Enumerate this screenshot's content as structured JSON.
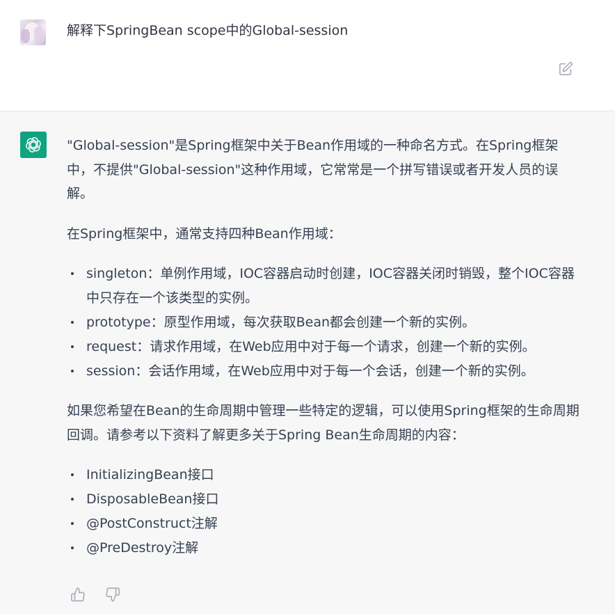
{
  "user_message": {
    "text": "解释下SpringBean scope中的Global-session",
    "avatar_icon": "user-avatar-image",
    "edit_icon": "edit-icon"
  },
  "assistant_message": {
    "avatar_icon": "openai-logo-icon",
    "avatar_color": "#10a37f",
    "paragraph_1": "\"Global-session\"是Spring框架中关于Bean作用域的一种命名方式。在Spring框架中，不提供\"Global-session\"这种作用域，它常常是一个拼写错误或者开发人员的误解。",
    "paragraph_2": "在Spring框架中，通常支持四种Bean作用域：",
    "scopes": [
      "singleton：单例作用域，IOC容器启动时创建，IOC容器关闭时销毁，整个IOC容器中只存在一个该类型的实例。",
      "prototype：原型作用域，每次获取Bean都会创建一个新的实例。",
      "request：请求作用域，在Web应用中对于每一个请求，创建一个新的实例。",
      "session：会话作用域，在Web应用中对于每一个会话，创建一个新的实例。"
    ],
    "paragraph_3": "如果您希望在Bean的生命周期中管理一些特定的逻辑，可以使用Spring框架的生命周期回调。请参考以下资料了解更多关于Spring Bean生命周期的内容：",
    "lifecycle_items": [
      "InitializingBean接口",
      "DisposableBean接口",
      "@PostConstruct注解",
      "@PreDestroy注解"
    ],
    "feedback_icons": [
      "thumbs-up-icon",
      "thumbs-down-icon"
    ]
  },
  "colors": {
    "assistant_background": "#f7f7f8",
    "user_background": "#ffffff",
    "text": "#374151",
    "icon_gray": "#acacbe"
  }
}
